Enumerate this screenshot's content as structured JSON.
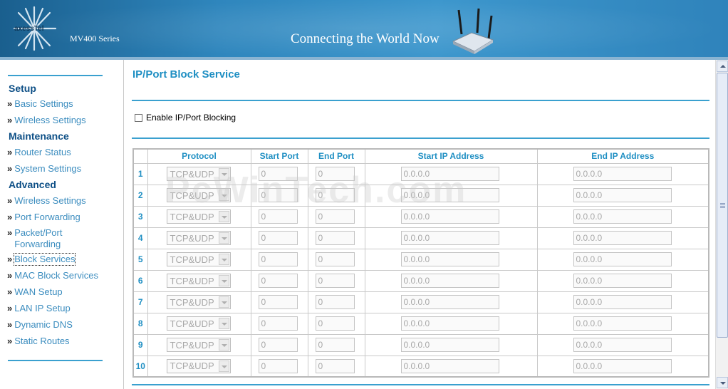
{
  "header": {
    "logo_text": "axessTel",
    "series": "MV400 Series",
    "tagline": "Connecting the World Now"
  },
  "sidebar": {
    "sections": [
      {
        "title": "Setup",
        "items": [
          "Basic Settings",
          "Wireless Settings"
        ]
      },
      {
        "title": "Maintenance",
        "items": [
          "Router Status",
          "System Settings"
        ]
      },
      {
        "title": "Advanced",
        "items": [
          "Wireless Settings",
          "Port Forwarding",
          "Packet/Port Forwarding",
          "Block Services",
          "MAC Block Services",
          "WAN Setup",
          "LAN IP Setup",
          "Dynamic DNS",
          "Static Routes"
        ]
      }
    ],
    "packet_port_line1": "Packet/Port",
    "packet_port_line2": "Forwarding",
    "active_item": "Block Services"
  },
  "main": {
    "title": "IP/Port Block Service",
    "enable_label": "Enable IP/Port Blocking",
    "enable_checked": false,
    "columns": [
      "",
      "Protocol",
      "Start Port",
      "End Port",
      "Start IP Address",
      "End IP Address"
    ],
    "rows": [
      {
        "num": "1",
        "protocol": "TCP&UDP",
        "start_port": "0",
        "end_port": "0",
        "start_ip": "0.0.0.0",
        "end_ip": "0.0.0.0"
      },
      {
        "num": "2",
        "protocol": "TCP&UDP",
        "start_port": "0",
        "end_port": "0",
        "start_ip": "0.0.0.0",
        "end_ip": "0.0.0.0"
      },
      {
        "num": "3",
        "protocol": "TCP&UDP",
        "start_port": "0",
        "end_port": "0",
        "start_ip": "0.0.0.0",
        "end_ip": "0.0.0.0"
      },
      {
        "num": "4",
        "protocol": "TCP&UDP",
        "start_port": "0",
        "end_port": "0",
        "start_ip": "0.0.0.0",
        "end_ip": "0.0.0.0"
      },
      {
        "num": "5",
        "protocol": "TCP&UDP",
        "start_port": "0",
        "end_port": "0",
        "start_ip": "0.0.0.0",
        "end_ip": "0.0.0.0"
      },
      {
        "num": "6",
        "protocol": "TCP&UDP",
        "start_port": "0",
        "end_port": "0",
        "start_ip": "0.0.0.0",
        "end_ip": "0.0.0.0"
      },
      {
        "num": "7",
        "protocol": "TCP&UDP",
        "start_port": "0",
        "end_port": "0",
        "start_ip": "0.0.0.0",
        "end_ip": "0.0.0.0"
      },
      {
        "num": "8",
        "protocol": "TCP&UDP",
        "start_port": "0",
        "end_port": "0",
        "start_ip": "0.0.0.0",
        "end_ip": "0.0.0.0"
      },
      {
        "num": "9",
        "protocol": "TCP&UDP",
        "start_port": "0",
        "end_port": "0",
        "start_ip": "0.0.0.0",
        "end_ip": "0.0.0.0"
      },
      {
        "num": "10",
        "protocol": "TCP&UDP",
        "start_port": "0",
        "end_port": "0",
        "start_ip": "0.0.0.0",
        "end_ip": "0.0.0.0"
      }
    ]
  },
  "watermark": "PcWinTech.com",
  "colors": {
    "accent": "#1f8fc3",
    "nav_link": "#3c8dbf",
    "section_title": "#0d4f86",
    "banner": "#2f86bd"
  }
}
